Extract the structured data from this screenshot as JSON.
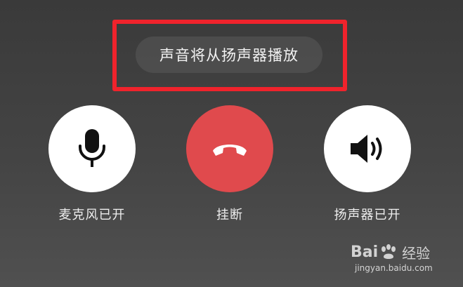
{
  "toast": {
    "text": "声音将从扬声器播放"
  },
  "controls": {
    "mute": {
      "label": "麦克风已开",
      "icon": "microphone-icon"
    },
    "hangup": {
      "label": "挂断",
      "icon": "hang-up-phone-icon",
      "color": "#e04a4d"
    },
    "speaker": {
      "label": "扬声器已开",
      "icon": "speaker-volume-icon"
    }
  },
  "highlight": {
    "color": "#f0232c"
  },
  "watermark": {
    "brand_latin_1": "Bai",
    "brand_latin_2": "",
    "brand_cn": "经验",
    "url": "jingyan.baidu.com"
  }
}
